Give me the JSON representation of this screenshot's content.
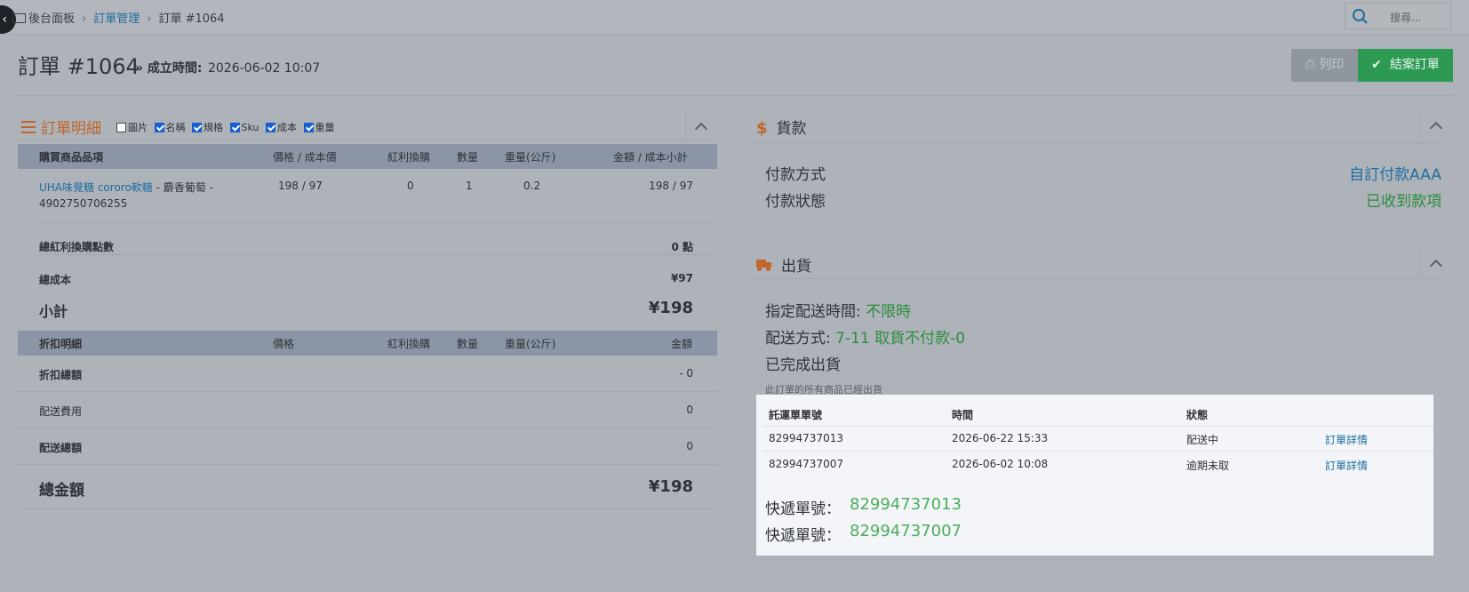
{
  "topbar": {
    "crumbs": [
      "後台面板",
      "訂單管理",
      "訂單 #1064"
    ],
    "search_placeholder": "搜尋..."
  },
  "header": {
    "title": "訂單 #1064",
    "created_label": "» 成立時間:",
    "created_value": "2026-06-02 10:07",
    "print_label": "列印",
    "close_label": "結案訂單"
  },
  "order_detail": {
    "title": "訂單明細",
    "toggles": [
      {
        "label": "圖片",
        "checked": false
      },
      {
        "label": "名稱",
        "checked": true
      },
      {
        "label": "規格",
        "checked": true
      },
      {
        "label": "Sku",
        "checked": true
      },
      {
        "label": "成本",
        "checked": true
      },
      {
        "label": "重量",
        "checked": true
      }
    ],
    "columns": [
      "購買商品品項",
      "價格 / 成本價",
      "紅利換購",
      "數量",
      "重量(公斤)",
      "金額 / 成本小計"
    ],
    "item": {
      "name": "UHA味覺糖 cororo軟糖",
      "variant": " - 麝香葡萄 -",
      "sku": "4902750706255",
      "price_cost": "198 / 97",
      "bonus": "0",
      "qty": "1",
      "weight": "0.2",
      "amount": "198 / 97"
    },
    "total_bonus_label": "總紅利換購點數",
    "total_bonus_value": "0 點",
    "total_cost_label": "總成本",
    "total_cost_value": "¥97",
    "subtotal_label": "小計",
    "subtotal_value": "¥198",
    "discount_columns": [
      "折扣明細",
      "價格",
      "紅利換購",
      "數量",
      "重量(公斤)",
      "金額"
    ],
    "discount_total_label": "折扣總額",
    "discount_total_value": "- 0",
    "shipping_fee_label": "配送費用",
    "shipping_fee_value": "0",
    "shipping_total_label": "配送總額",
    "shipping_total_value": "0",
    "grand_total_label": "總金額",
    "grand_total_value": "¥198"
  },
  "payment": {
    "title": "貨款",
    "method_label": "付款方式",
    "method_value": "自訂付款AAA",
    "status_label": "付款狀態",
    "status_value": "已收到款項"
  },
  "shipping": {
    "title": "出貨",
    "time_label": "指定配送時間:",
    "time_value": "不限時",
    "method_label": "配送方式:",
    "method_value": "7-11 取貨不付款-0",
    "done_text": "已完成出貨",
    "note": "此訂單的所有商品已經出貨",
    "table_columns": [
      "託運單單號",
      "時間",
      "狀態"
    ],
    "rows": [
      {
        "no": "82994737013",
        "time": "2026-06-22 15:33",
        "status": "配送中",
        "link": "訂單詳情"
      },
      {
        "no": "82994737007",
        "time": "2026-06-02 10:08",
        "status": "逾期未取",
        "link": "訂單詳情"
      }
    ],
    "tracking_label": "快遞單號：",
    "tracking": [
      "82994737013",
      "82994737007"
    ]
  }
}
